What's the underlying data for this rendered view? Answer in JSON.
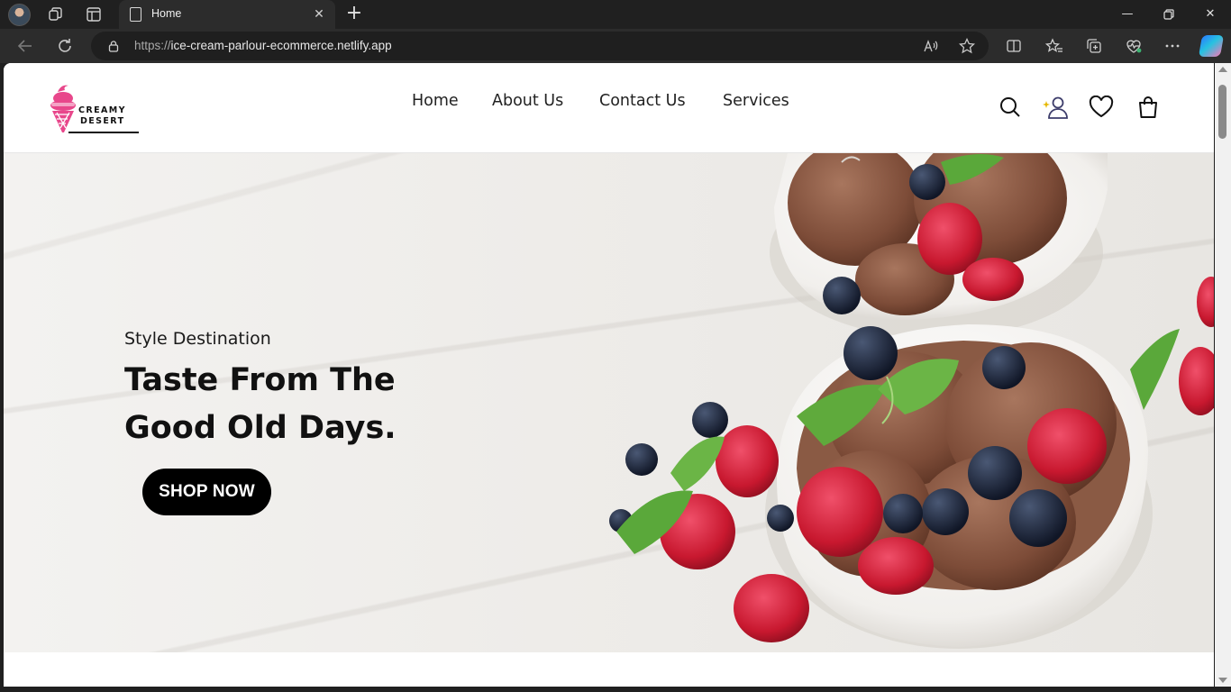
{
  "browser": {
    "tab": {
      "title": "Home"
    },
    "address": {
      "url_scheme": "https://",
      "url_host": "ice-cream-parlour-ecommerce.netlify.app"
    },
    "icons": {
      "profile": "profile-avatar",
      "workspaces": "workspaces-icon",
      "tab_actions": "tab-actions-icon",
      "back": "back-arrow-icon",
      "refresh": "refresh-icon",
      "lock": "lock-icon",
      "read_aloud": "read-aloud-icon",
      "favorite": "star-icon",
      "split_screen": "split-screen-icon",
      "favorites": "favorites-icon",
      "collections": "collections-icon",
      "browser_essentials": "heart-pulse-icon",
      "more": "more-icon",
      "copilot": "copilot-icon"
    }
  },
  "site": {
    "logo": {
      "line1": "CREAMY",
      "line2": "DESERT",
      "brand_color": "#e8478b"
    },
    "nav": [
      {
        "label": "Home"
      },
      {
        "label": "About Us"
      },
      {
        "label": "Contact Us"
      },
      {
        "label": "Services"
      }
    ],
    "header_icons": [
      "search-icon",
      "user-icon",
      "heart-icon",
      "shopping-bag-icon"
    ],
    "hero": {
      "subtitle": "Style Destination",
      "title_line1": "Taste From The",
      "title_line2": "Good Old Days.",
      "cta": "SHOP NOW",
      "cta_color": "#000000"
    }
  }
}
